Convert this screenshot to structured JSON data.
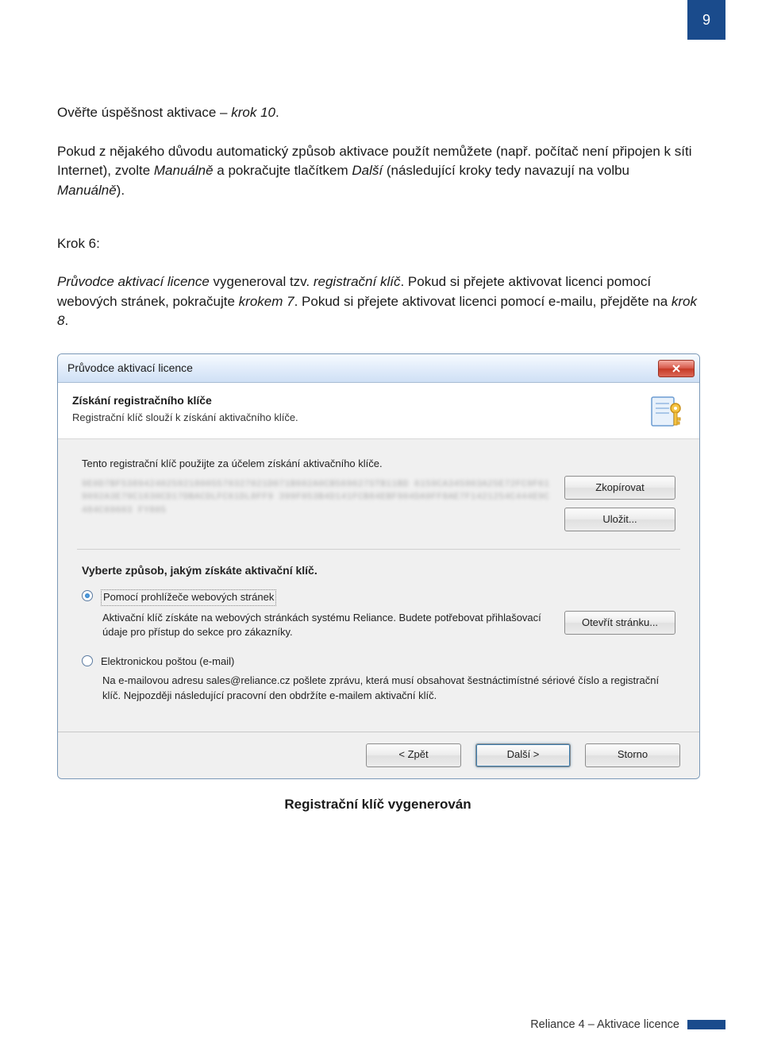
{
  "page_number": "9",
  "body": {
    "para1_pre": "Ověřte úspěšnost aktivace – ",
    "para1_step": "krok 10",
    "para1_post": ".",
    "para2_pre": "Pokud z nějakého důvodu automatický způsob aktivace použít nemůžete (např. počítač není připojen k síti Internet), zvolte ",
    "para2_m1": "Manuálně",
    "para2_mid": " a pokračujte tlačítkem ",
    "para2_d": "Další",
    "para2_mid2": " (následující kroky tedy navazují na volbu ",
    "para2_m2": "Manuálně",
    "para2_post": ").",
    "step_label": "Krok 6:",
    "para3_pre": "Průvodce aktivací licence",
    "para3_mid1": " vygeneroval tzv. ",
    "para3_regkey": "registrační klíč",
    "para3_mid2": ". Pokud si přejete aktivovat licenci pomocí webových stránek, pokračujte ",
    "para3_step7": "krokem 7",
    "para3_mid3": ". Pokud si přejete aktivovat licenci pomocí e-mailu, přejděte na ",
    "para3_step8": "krok 8",
    "para3_post": "."
  },
  "dialog": {
    "title": "Průvodce aktivací licence",
    "header_title": "Získání registračního klíče",
    "header_sub": "Registrační klíč slouží k získání aktivačního klíče.",
    "key_hint": "Tento registrační klíč použijte za účelem získání aktivačního klíče.",
    "key_text": "9E0D7BF53894240259218005570327021D071B602A0CB569627STB11BD 6159CA345903A25E72FC9F619092A3E79C1630CD17DBACDLFC61DL8FF9 399F053B4D141FCB84EBF904DA9FF8AE7F1421254C444E9C484C69603 FY805",
    "copy_btn": "Zkopírovat",
    "save_btn": "Uložit...",
    "section_title": "Vyberte způsob, jakým získáte aktivační klíč.",
    "option1_label": "Pomocí prohlížeče webových stránek",
    "option1_desc": "Aktivační klíč získáte na webových stránkách systému Reliance. Budete potřebovat přihlašovací údaje pro přístup do sekce pro zákazníky.",
    "open_page_btn": "Otevřít stránku...",
    "option2_label": "Elektronickou poštou (e-mail)",
    "option2_desc": "Na e-mailovou adresu sales@reliance.cz pošlete zprávu, která musí obsahovat šestnáctimístné sériové číslo a registrační klíč. Nejpozději následující pracovní den obdržíte e-mailem aktivační klíč.",
    "back_btn": "< Zpět",
    "next_btn": "Další >",
    "cancel_btn": "Storno"
  },
  "caption": "Registrační klíč vygenerován",
  "footer": "Reliance 4 – Aktivace licence"
}
